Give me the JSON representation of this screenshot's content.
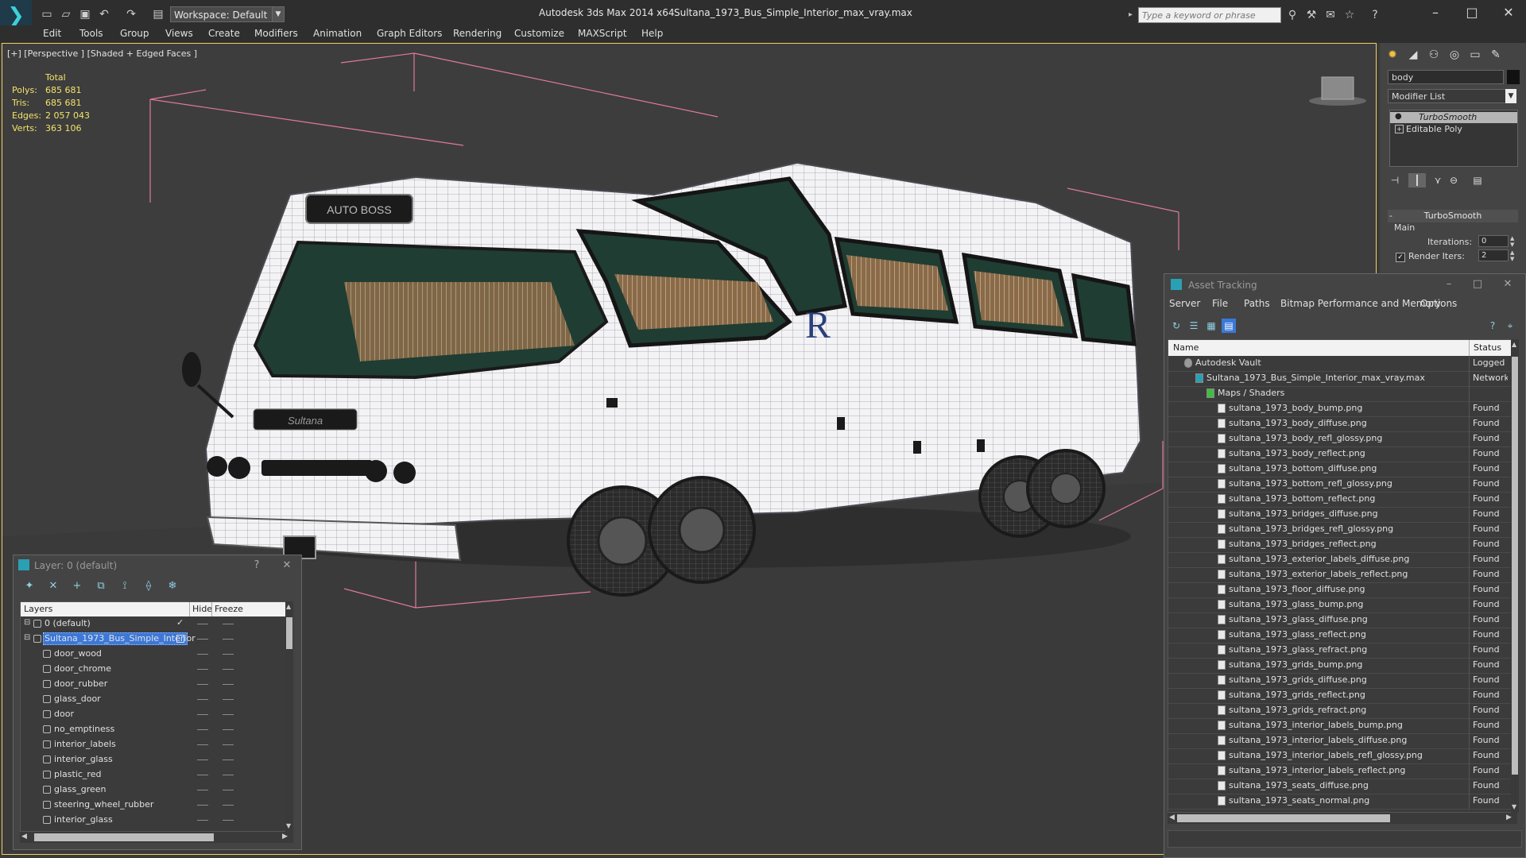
{
  "app": {
    "logo_glyph": "❯",
    "title": "Autodesk 3ds Max  2014 x64",
    "file_title": "Sultana_1973_Bus_Simple_Interior_max_vray.max",
    "workspace_value": "Workspace: Default",
    "search_placeholder": "Type a keyword or phrase"
  },
  "menu": [
    "Edit",
    "Tools",
    "Group",
    "Views",
    "Create",
    "Modifiers",
    "Animation",
    "Graph Editors",
    "Rendering",
    "Customize",
    "MAXScript",
    "Help"
  ],
  "viewport": {
    "label": "[+] [Perspective ] [Shaded + Edged Faces ]",
    "stats": {
      "total_label": "Total",
      "rows": [
        {
          "label": "Polys:",
          "value": "685 681"
        },
        {
          "label": "Tris:",
          "value": "685 681"
        },
        {
          "label": "Edges:",
          "value": "2 057 043"
        },
        {
          "label": "Verts:",
          "value": "363 106"
        }
      ]
    },
    "bus_sign_text": "AUTO BOSS",
    "bus_grille_text": "Sultana"
  },
  "command_panel": {
    "object_name": "body",
    "modifier_list": "Modifier List",
    "stack": [
      {
        "label": "TurboSmooth"
      },
      {
        "label": "Editable Poly"
      }
    ],
    "rollout_title": "TurboSmooth",
    "group_main": "Main",
    "iterations_label": "Iterations:",
    "iterations_value": "0",
    "render_iters_label": "Render Iters:",
    "render_iters_value": "2"
  },
  "asset_tracking": {
    "title": "Asset Tracking",
    "menu": [
      "Server",
      "File",
      "Paths",
      "Bitmap Performance and Memory",
      "Options"
    ],
    "columns": {
      "name": "Name",
      "status": "Status"
    },
    "rows": [
      {
        "name": "Autodesk Vault",
        "status": "Logged O",
        "indent": 1,
        "icon": "vault"
      },
      {
        "name": "Sultana_1973_Bus_Simple_Interior_max_vray.max",
        "status": "Network",
        "indent": 2,
        "icon": "max"
      },
      {
        "name": "Maps / Shaders",
        "status": "",
        "indent": 3,
        "icon": "maps"
      },
      {
        "name": "sultana_1973_body_bump.png",
        "status": "Found",
        "indent": 4,
        "icon": "file"
      },
      {
        "name": "sultana_1973_body_diffuse.png",
        "status": "Found",
        "indent": 4,
        "icon": "file"
      },
      {
        "name": "sultana_1973_body_refl_glossy.png",
        "status": "Found",
        "indent": 4,
        "icon": "file"
      },
      {
        "name": "sultana_1973_body_reflect.png",
        "status": "Found",
        "indent": 4,
        "icon": "file"
      },
      {
        "name": "sultana_1973_bottom_diffuse.png",
        "status": "Found",
        "indent": 4,
        "icon": "file"
      },
      {
        "name": "sultana_1973_bottom_refl_glossy.png",
        "status": "Found",
        "indent": 4,
        "icon": "file"
      },
      {
        "name": "sultana_1973_bottom_reflect.png",
        "status": "Found",
        "indent": 4,
        "icon": "file"
      },
      {
        "name": "sultana_1973_bridges_diffuse.png",
        "status": "Found",
        "indent": 4,
        "icon": "file"
      },
      {
        "name": "sultana_1973_bridges_refl_glossy.png",
        "status": "Found",
        "indent": 4,
        "icon": "file"
      },
      {
        "name": "sultana_1973_bridges_reflect.png",
        "status": "Found",
        "indent": 4,
        "icon": "file"
      },
      {
        "name": "sultana_1973_exterior_labels_diffuse.png",
        "status": "Found",
        "indent": 4,
        "icon": "file"
      },
      {
        "name": "sultana_1973_exterior_labels_reflect.png",
        "status": "Found",
        "indent": 4,
        "icon": "file"
      },
      {
        "name": "sultana_1973_floor_diffuse.png",
        "status": "Found",
        "indent": 4,
        "icon": "file"
      },
      {
        "name": "sultana_1973_glass_bump.png",
        "status": "Found",
        "indent": 4,
        "icon": "file"
      },
      {
        "name": "sultana_1973_glass_diffuse.png",
        "status": "Found",
        "indent": 4,
        "icon": "file"
      },
      {
        "name": "sultana_1973_glass_reflect.png",
        "status": "Found",
        "indent": 4,
        "icon": "file"
      },
      {
        "name": "sultana_1973_glass_refract.png",
        "status": "Found",
        "indent": 4,
        "icon": "file"
      },
      {
        "name": "sultana_1973_grids_bump.png",
        "status": "Found",
        "indent": 4,
        "icon": "file"
      },
      {
        "name": "sultana_1973_grids_diffuse.png",
        "status": "Found",
        "indent": 4,
        "icon": "file"
      },
      {
        "name": "sultana_1973_grids_reflect.png",
        "status": "Found",
        "indent": 4,
        "icon": "file"
      },
      {
        "name": "sultana_1973_grids_refract.png",
        "status": "Found",
        "indent": 4,
        "icon": "file"
      },
      {
        "name": "sultana_1973_interior_labels_bump.png",
        "status": "Found",
        "indent": 4,
        "icon": "file"
      },
      {
        "name": "sultana_1973_interior_labels_diffuse.png",
        "status": "Found",
        "indent": 4,
        "icon": "file"
      },
      {
        "name": "sultana_1973_interior_labels_refl_glossy.png",
        "status": "Found",
        "indent": 4,
        "icon": "file"
      },
      {
        "name": "sultana_1973_interior_labels_reflect.png",
        "status": "Found",
        "indent": 4,
        "icon": "file"
      },
      {
        "name": "sultana_1973_seats_diffuse.png",
        "status": "Found",
        "indent": 4,
        "icon": "file"
      },
      {
        "name": "sultana_1973_seats_normal.png",
        "status": "Found",
        "indent": 4,
        "icon": "file"
      }
    ]
  },
  "layer_manager": {
    "title": "Layer: 0 (default)",
    "help_glyph": "?",
    "close_glyph": "✕",
    "columns": {
      "layers": "Layers",
      "hide": "Hide",
      "freeze": "Freeze"
    },
    "rows": [
      {
        "name": "0 (default)",
        "type": "layer",
        "current": true,
        "selected": false
      },
      {
        "name": "Sultana_1973_Bus_Simple_Interior",
        "type": "layer",
        "current": false,
        "selected": true
      },
      {
        "name": "door_wood",
        "type": "object"
      },
      {
        "name": "door_chrome",
        "type": "object"
      },
      {
        "name": "door_rubber",
        "type": "object"
      },
      {
        "name": "glass_door",
        "type": "object"
      },
      {
        "name": "door",
        "type": "object"
      },
      {
        "name": "no_emptiness",
        "type": "object"
      },
      {
        "name": "interior_labels",
        "type": "object"
      },
      {
        "name": "interior_glass",
        "type": "object"
      },
      {
        "name": "plastic_red",
        "type": "object"
      },
      {
        "name": "glass_green",
        "type": "object"
      },
      {
        "name": "steering_wheel_rubber",
        "type": "object"
      },
      {
        "name": "interior_glass",
        "type": "object"
      }
    ]
  },
  "colors": {
    "viewport_border": "#f1d15f",
    "stats_text": "#f4e36a",
    "selection_blue": "#3b78d8",
    "bbox_pink": "#e07a9a"
  }
}
